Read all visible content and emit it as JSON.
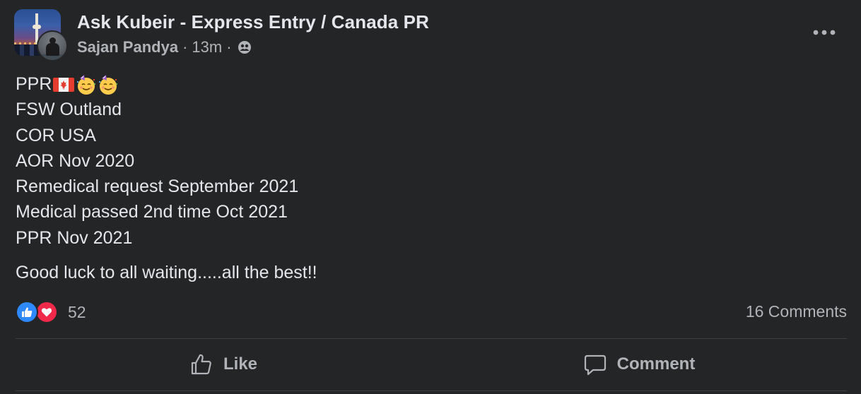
{
  "post": {
    "group_name": "Ask Kubeir - Express Entry / Canada PR",
    "author": "Sajan Pandya",
    "time": "13m",
    "separator": "·",
    "audience_icon": "group-audience-icon",
    "body_lines": [
      "PPR",
      "FSW Outland",
      "COR USA",
      "AOR Nov 2020",
      "Remedical request September 2021",
      "Medical passed 2nd time Oct 2021",
      "PPR Nov 2021"
    ],
    "emojis": [
      "canada-flag",
      "partying-face",
      "partying-face"
    ],
    "closing": "Good luck to all waiting.....all the best!!"
  },
  "reactions": {
    "count": "52",
    "types": [
      "like",
      "love"
    ],
    "comments": "16 Comments"
  },
  "actions": {
    "like_label": "Like",
    "comment_label": "Comment"
  },
  "colors": {
    "background": "#242526",
    "primary_text": "#e4e6eb",
    "secondary_text": "#b0b3b8",
    "like_blue": "#2e89ff",
    "love_red": "#f0284a",
    "divider": "#3e4042"
  }
}
